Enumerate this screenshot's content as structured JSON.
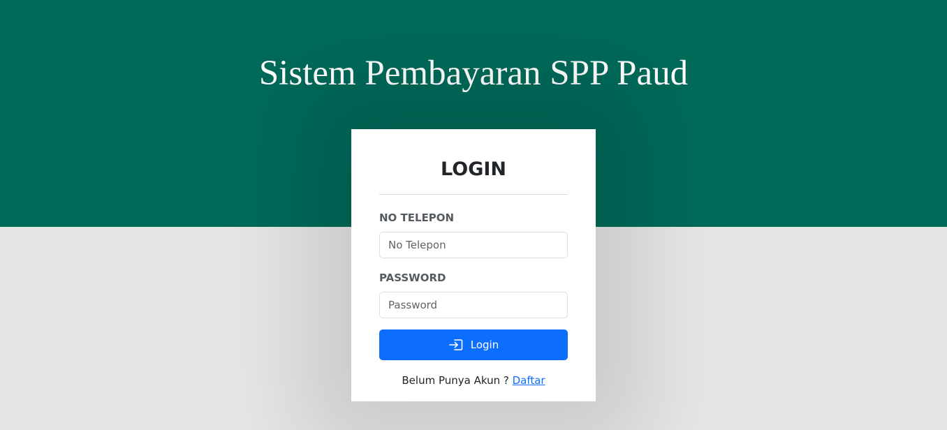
{
  "header": {
    "title": "Sistem Pembayaran SPP Paud"
  },
  "login": {
    "heading": "LOGIN",
    "phone_label": "NO TELEPON",
    "phone_placeholder": "No Telepon",
    "phone_value": "",
    "password_label": "PASSWORD",
    "password_placeholder": "Password",
    "password_value": "",
    "button_label": "Login",
    "button_icon": "login-icon",
    "signup_prompt": "Belum Punya Akun ?",
    "signup_link": "Daftar"
  },
  "colors": {
    "header_bg": "#006a59",
    "page_bg": "#e6e6e6",
    "primary": "#0d6efd"
  }
}
